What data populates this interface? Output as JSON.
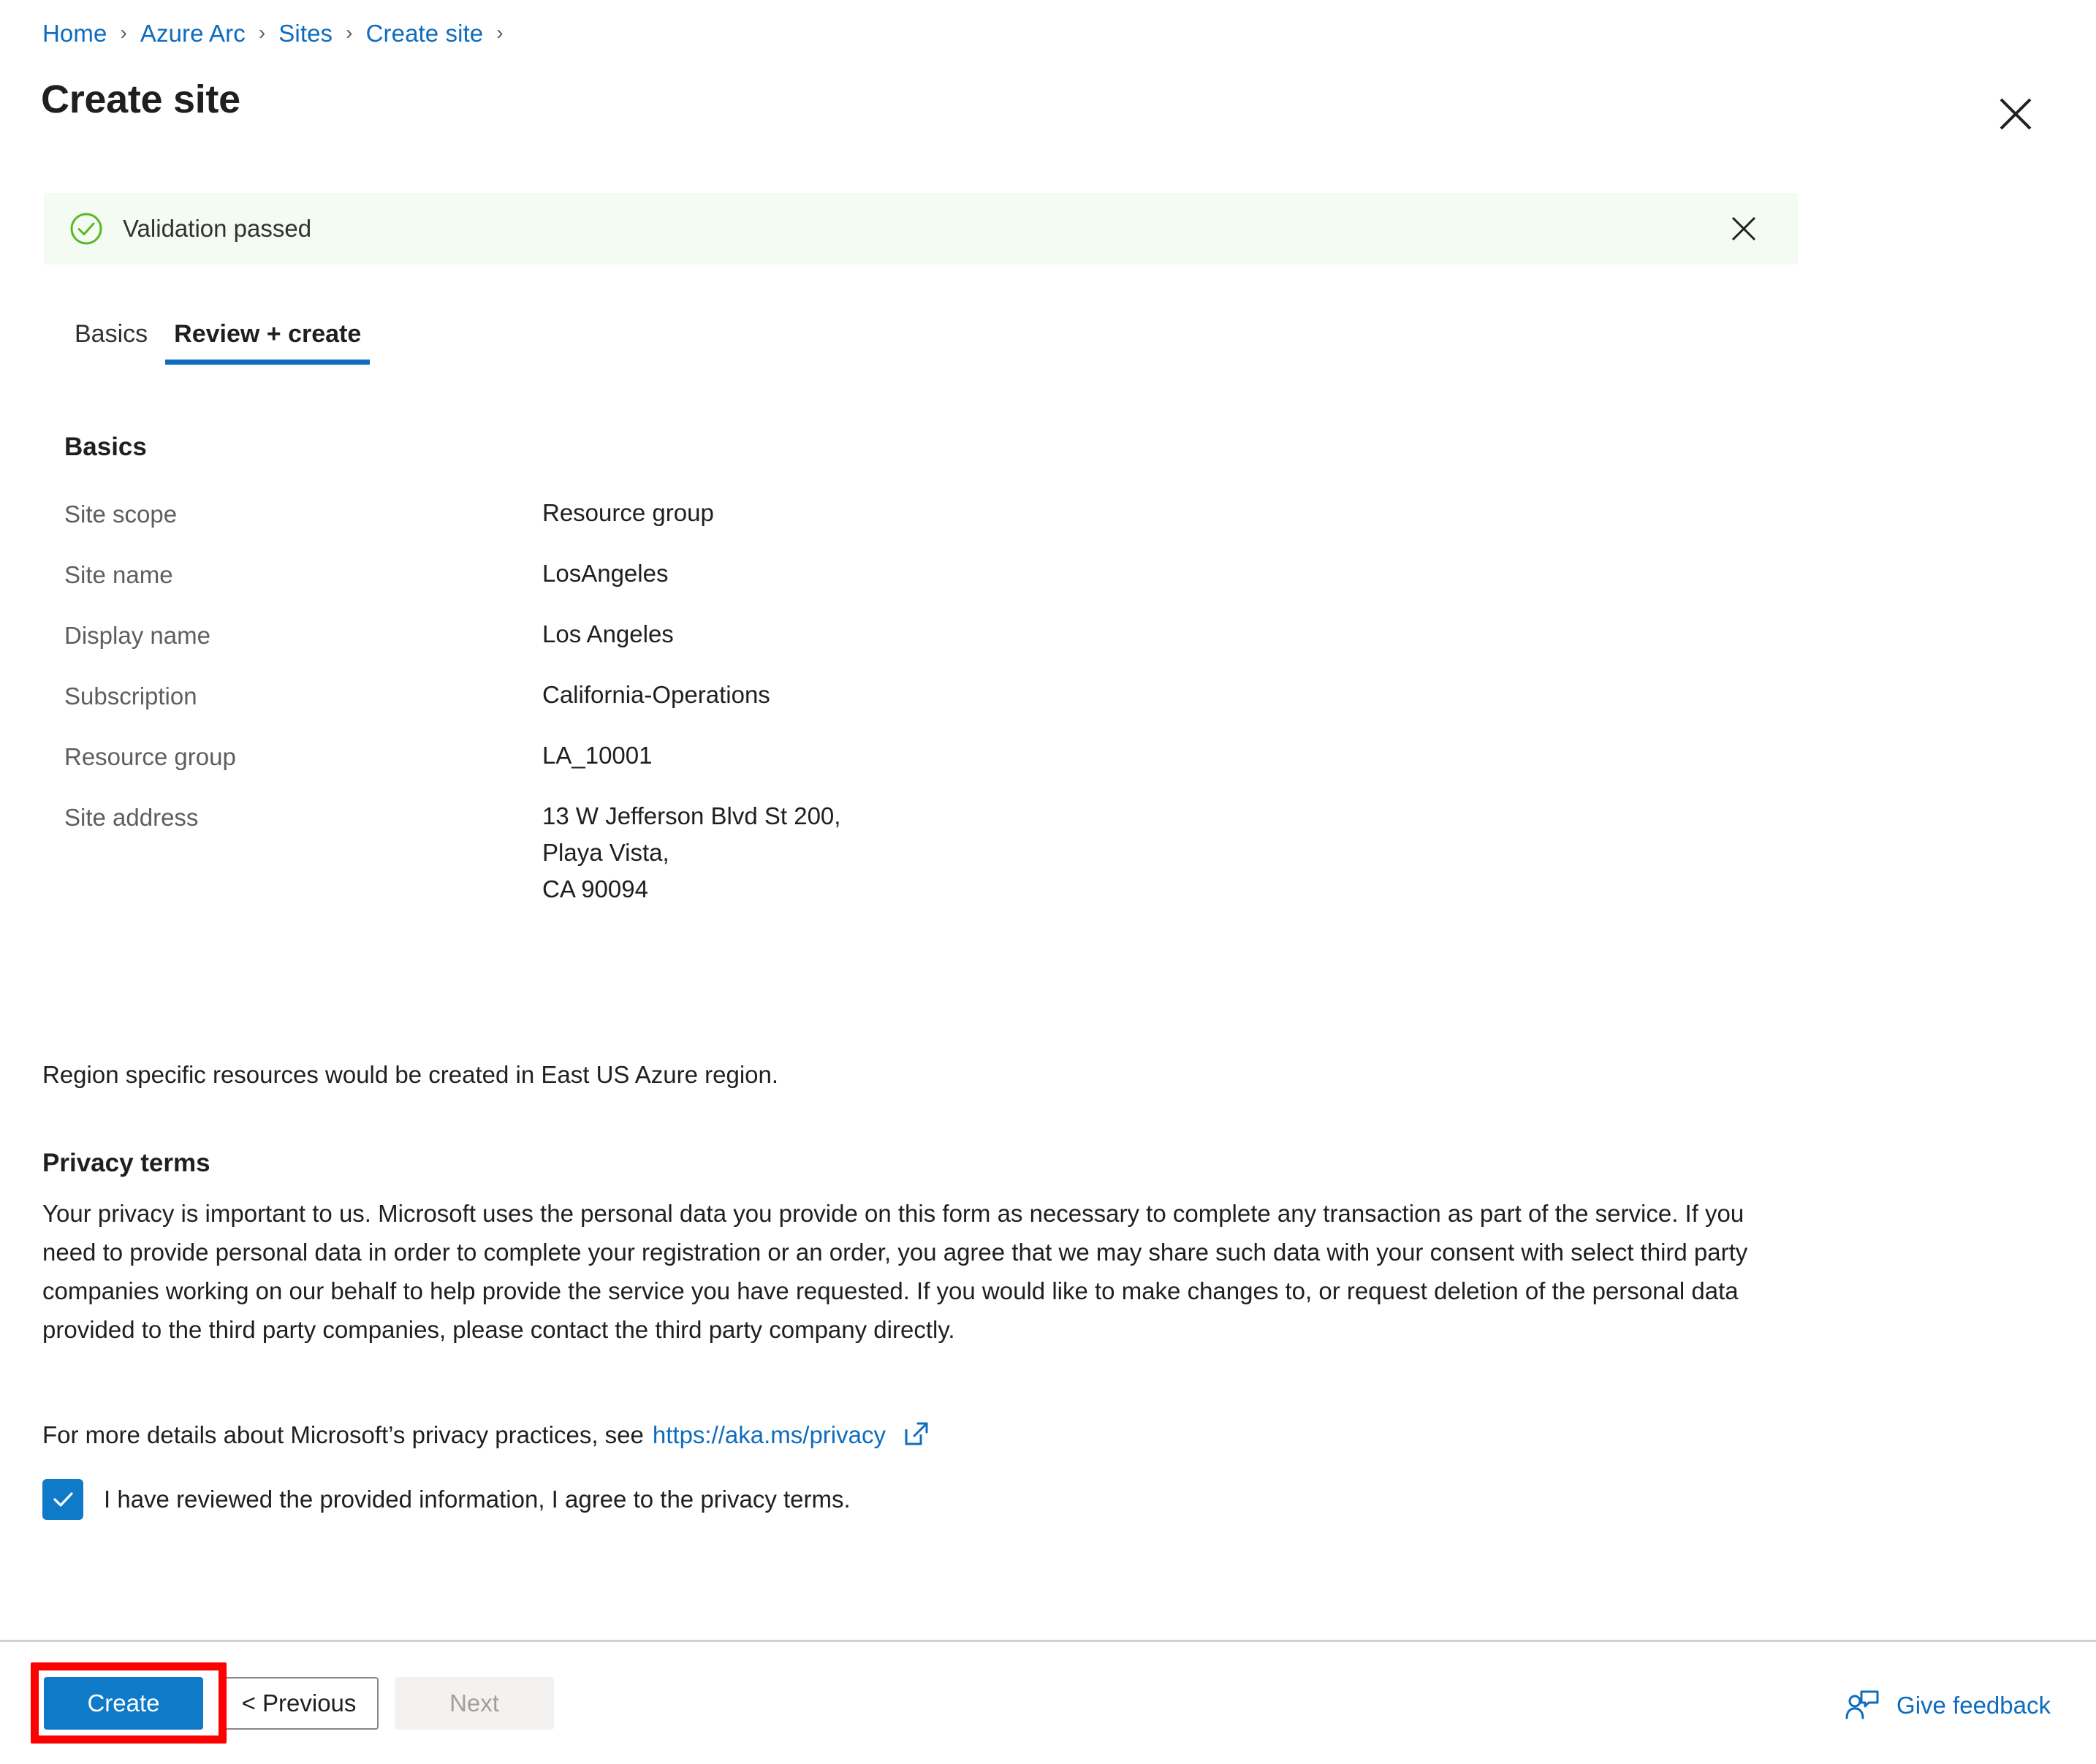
{
  "breadcrumb": {
    "items": [
      {
        "label": "Home"
      },
      {
        "label": "Azure Arc"
      },
      {
        "label": "Sites"
      },
      {
        "label": "Create site"
      }
    ],
    "separator": "›"
  },
  "header": {
    "title": "Create site",
    "close_icon": "close-icon"
  },
  "banner": {
    "message": "Validation passed",
    "status_icon": "check-circle-icon",
    "close_icon": "close-icon",
    "background_color": "#f4fbf2",
    "accent_color": "#5ab825"
  },
  "tabs": [
    {
      "label": "Basics",
      "active": false
    },
    {
      "label": "Review + create",
      "active": true
    }
  ],
  "basics": {
    "heading": "Basics",
    "rows": [
      {
        "label": "Site scope",
        "value": "Resource group"
      },
      {
        "label": "Site name",
        "value": "LosAngeles"
      },
      {
        "label": "Display name",
        "value": "Los Angeles"
      },
      {
        "label": "Subscription",
        "value": "California-Operations"
      },
      {
        "label": "Resource group",
        "value": "LA_10001"
      }
    ],
    "address_row": {
      "label": "Site address",
      "lines": [
        "13 W Jefferson Blvd St 200,",
        "Playa Vista,",
        "CA 90094"
      ]
    }
  },
  "region_note": "Region specific resources would be created in East US Azure region.",
  "privacy": {
    "heading": "Privacy terms",
    "body": "Your privacy is important to us. Microsoft uses the personal data you provide on this form as necessary to complete any transaction as part of the service. If you need to provide personal data in order to complete your registration or an order, you agree that we may share such data with your consent with select third party companies working on our behalf to help provide the service you have requested. If you would like to make changes to, or request deletion of the personal data provided to the third party companies, please contact the third party company directly.",
    "more_text": "For more details about Microsoft’s privacy practices, see",
    "link_text": "https://aka.ms/privacy",
    "link_icon": "external-link-icon",
    "consent_label": "I have reviewed the provided information, I agree to the privacy terms.",
    "consent_checked": true,
    "checkbox_color": "#0f7ac8"
  },
  "footer": {
    "create_label": "Create",
    "previous_label": "< Previous",
    "next_label": "Next",
    "next_disabled": true,
    "feedback_label": "Give feedback",
    "feedback_icon": "person-feedback-icon",
    "highlight_color": "#fd0000"
  }
}
